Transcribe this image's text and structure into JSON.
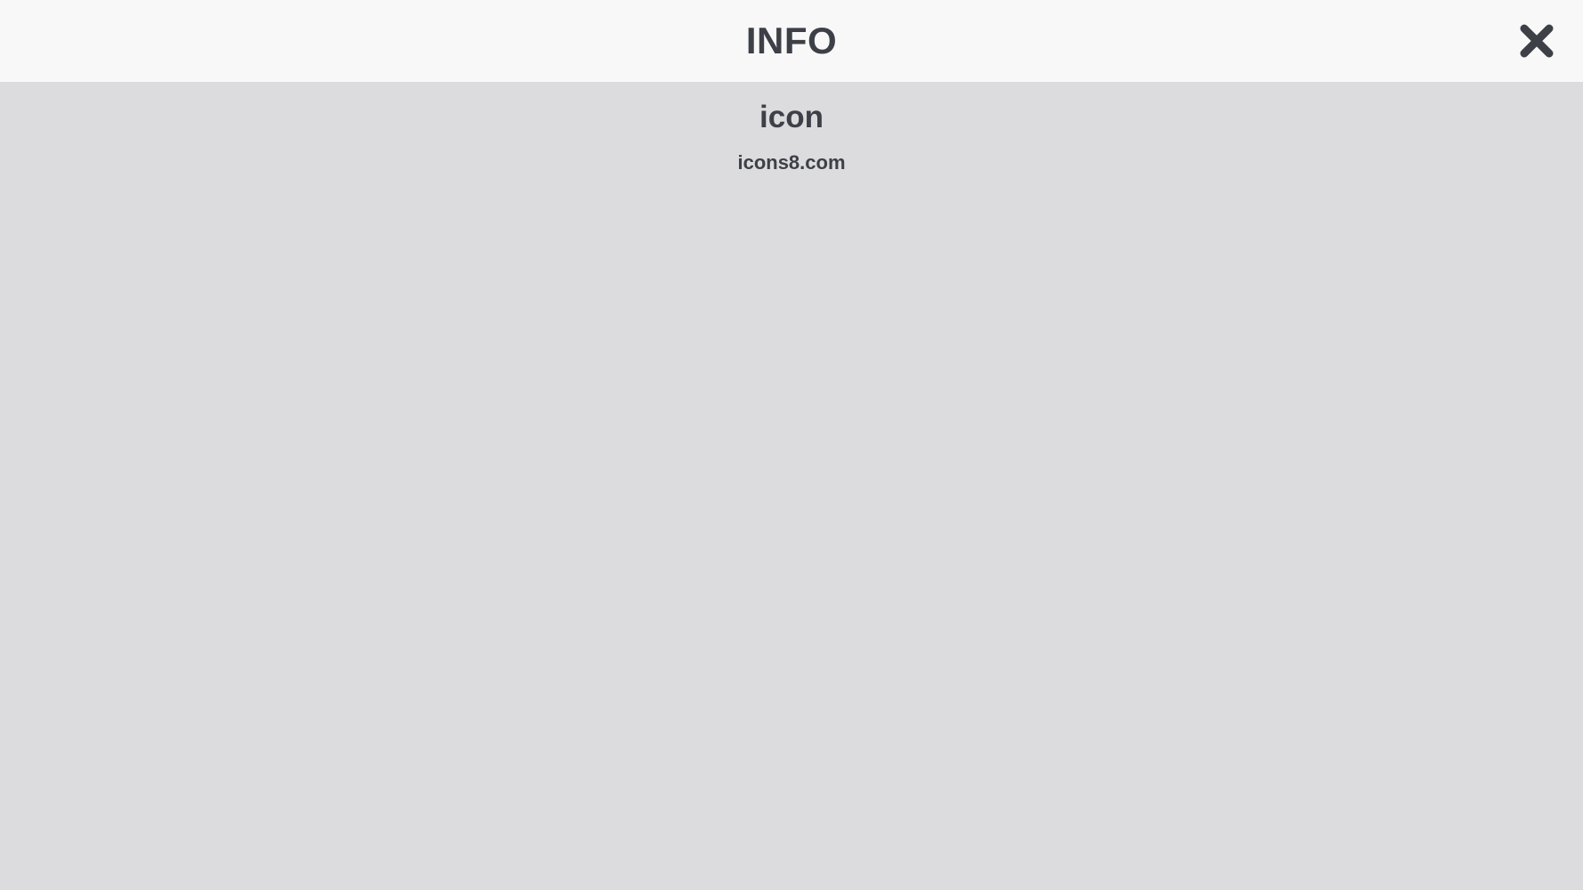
{
  "header": {
    "title": "INFO",
    "close_icon": "close-icon"
  },
  "content": {
    "title": "icon",
    "subtitle": "icons8.com"
  },
  "colors": {
    "header_bg": "#f8f8f9",
    "content_bg": "#dcdbde",
    "text": "#3d4047"
  }
}
